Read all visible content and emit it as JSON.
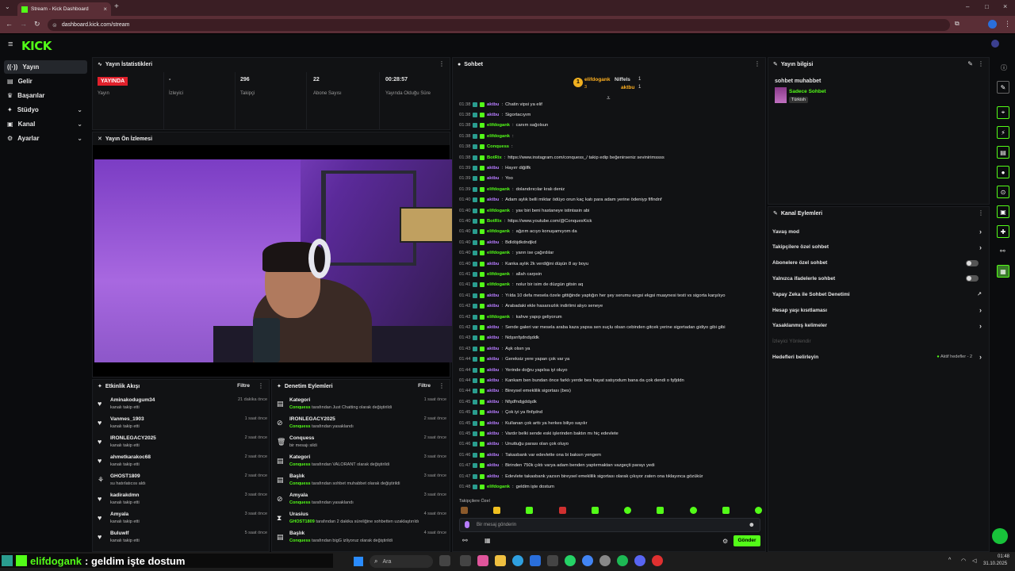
{
  "browser": {
    "tab_title": "Stream - Kick Dashboard",
    "url": "dashboard.kick.com/stream"
  },
  "brand": {
    "logo": "KICK"
  },
  "sidebar": {
    "items": [
      {
        "label": "Yayın"
      },
      {
        "label": "Gelir"
      },
      {
        "label": "Başarılar"
      },
      {
        "label": "Stüdyo"
      },
      {
        "label": "Kanal"
      },
      {
        "label": "Ayarlar"
      }
    ]
  },
  "stats": {
    "title": "Yayın İstatistikleri",
    "live_badge": "YAYINDA",
    "live_label": "Yayın",
    "viewers_value": "-",
    "viewers_label": "İzleyici",
    "followers_value": "296",
    "followers_label": "Takipçi",
    "subs_value": "22",
    "subs_label": "Abone Sayısı",
    "uptime_value": "00:28:57",
    "uptime_label": "Yayında Olduğu Süre"
  },
  "preview": {
    "title": "Yayın Ön İzlemesi"
  },
  "activity": {
    "title": "Etkinlik Akışı",
    "filter": "Filtre",
    "rows": [
      {
        "name": "Aminakodugum34",
        "sub": "kanalı takip etti",
        "time": "21 dakika önce"
      },
      {
        "name": "Vanmes_1903",
        "sub": "kanalı takip etti",
        "time": "1 saat önce"
      },
      {
        "name": "IRONLEGACY2025",
        "sub": "kanalı takip etti",
        "time": "2 saat önce"
      },
      {
        "name": "ahmetkarakoc68",
        "sub": "kanalı takip etti",
        "time": "2 saat önce"
      },
      {
        "name": "GHOST1809",
        "sub": "su hatırlatıcısı aldı",
        "time": "2 saat önce"
      },
      {
        "name": "kadirakdmn",
        "sub": "kanalı takip etti",
        "time": "3 saat önce"
      },
      {
        "name": "Amyala",
        "sub": "kanalı takip etti",
        "time": "3 saat önce"
      },
      {
        "name": "Buluwlf",
        "sub": "kanalı takip etti",
        "time": "5 saat önce"
      }
    ]
  },
  "moderation": {
    "title": "Denetim Eylemleri",
    "filter": "Filtre",
    "rows": [
      {
        "name": "Kategori",
        "actor": "Conquess",
        "sub": "tarafından Just Chatting olarak değiştirildi",
        "time": "1 saat önce"
      },
      {
        "name": "IRONLEGACY2025",
        "actor": "Conquess",
        "sub": "tarafından yasaklandı",
        "time": "2 saat önce"
      },
      {
        "name": "Conquess",
        "actor": "",
        "sub": "bir mesajı sildi",
        "time": "2 saat önce"
      },
      {
        "name": "Kategori",
        "actor": "Conquess",
        "sub": "tarafından VALORANT olarak değiştirildi",
        "time": "3 saat önce"
      },
      {
        "name": "Başlık",
        "actor": "Conquess",
        "sub": "tarafından sohbet muhabbet olarak değiştirildi",
        "time": "3 saat önce"
      },
      {
        "name": "Amyala",
        "actor": "Conquess",
        "sub": "tarafından yasaklandı",
        "time": "3 saat önce"
      },
      {
        "name": "Urasius",
        "actor": "GHOST1809",
        "sub": "tarafından 2 dakika süreliğine sohbetten uzaklaştırıldı",
        "time": "4 saat önce"
      },
      {
        "name": "Başlık",
        "actor": "Conquess",
        "sub": "tarafından bigG izliyoruz olarak değiştirildi",
        "time": "4 saat önce"
      }
    ]
  },
  "chat": {
    "title": "Sohbet",
    "top1": "elifdogank",
    "top1_count": "3",
    "top2": "Niffels",
    "top2_count": "1",
    "top3": "aktbu",
    "top3_count": "1",
    "messages": [
      {
        "t": "01:38",
        "u": "aktbu",
        "c": "purple",
        "m": "Chatin vipsi ya elif"
      },
      {
        "t": "01:38",
        "u": "aktbu",
        "c": "purple",
        "m": "Sigortacıyım"
      },
      {
        "t": "01:38",
        "u": "elifdogank",
        "c": "green",
        "m": "canım sağolsun"
      },
      {
        "t": "01:38",
        "u": "elifdogank",
        "c": "green",
        "m": ""
      },
      {
        "t": "01:38",
        "u": "Conquess",
        "c": "green",
        "m": ""
      },
      {
        "t": "01:38",
        "u": "BotRix",
        "c": "green",
        "m": "https://www.instagram.com/conquess_/ takip edip beğenirseniz sevinirimssss"
      },
      {
        "t": "01:39",
        "u": "aktbu",
        "c": "purple",
        "m": "Hayırr diğilfk"
      },
      {
        "t": "01:39",
        "u": "aktbu",
        "c": "purple",
        "m": "Yoo"
      },
      {
        "t": "01:39",
        "u": "elifdogank",
        "c": "green",
        "m": "dolandırıcılar kralı deniz"
      },
      {
        "t": "01:40",
        "u": "aktbu",
        "c": "purple",
        "m": "Adam aylık belli miktar ödüyo orun kaç katı para adam yerine ödeniyp fiflndnf"
      },
      {
        "t": "01:40",
        "u": "elifdogank",
        "c": "green",
        "m": "yav biri beni hastaneye istintasin abi"
      },
      {
        "t": "01:40",
        "u": "BotRix",
        "c": "green",
        "m": "https://www.youtube.com/@ConquesKick"
      },
      {
        "t": "01:40",
        "u": "elifdogank",
        "c": "green",
        "m": "ağzım acıyo konuşamıyom da"
      },
      {
        "t": "01:40",
        "u": "aktbu",
        "c": "purple",
        "m": "Bdldöjdkdndjkd"
      },
      {
        "t": "01:40",
        "u": "elifdogank",
        "c": "green",
        "m": "yarın ise çağırdılar"
      },
      {
        "t": "01:40",
        "u": "aktbu",
        "c": "purple",
        "m": "Kanka aylık 2k verdiğini düşün 8 ay boyu"
      },
      {
        "t": "01:41",
        "u": "elifdogank",
        "c": "green",
        "m": "allah carpsin"
      },
      {
        "t": "01:41",
        "u": "elifdogank",
        "c": "green",
        "m": "nolur bir isim de düzgün gitsin aq"
      },
      {
        "t": "01:41",
        "u": "aktbu",
        "c": "purple",
        "m": "Yılda 10 defa mesela özele gittiğinde yaptığın her şey serumu eegsi ekgsi muaynesi testi vs sigorta karşılıyo"
      },
      {
        "t": "01:42",
        "u": "aktbu",
        "c": "purple",
        "m": "Arabadaki ekle hasarsızlık indirlimi alıyo seneye"
      },
      {
        "t": "01:42",
        "u": "elifdogank",
        "c": "green",
        "m": "kahve yapıp geliyorum"
      },
      {
        "t": "01:42",
        "u": "aktbu",
        "c": "purple",
        "m": "Sende galeri var mesela araba kaza yapsa sen suçlu olsan cebinden gitcek yerine sigortadan gidiyo gibi gibi"
      },
      {
        "t": "01:43",
        "u": "aktbu",
        "c": "purple",
        "m": "Ndşsnfşdndşddk"
      },
      {
        "t": "01:43",
        "u": "aktbu",
        "c": "purple",
        "m": "Aşk olsın ya"
      },
      {
        "t": "01:44",
        "u": "aktbu",
        "c": "purple",
        "m": "Gereksiz yere yapan çok var ya"
      },
      {
        "t": "01:44",
        "u": "aktbu",
        "c": "purple",
        "m": "Yerinde doğru yapılsa iyi oluyo"
      },
      {
        "t": "01:44",
        "u": "aktbu",
        "c": "purple",
        "m": "Kankam ben bundan önce farklı yerde bes hayat satıyodum bana da çok dendi o fşfjddn"
      },
      {
        "t": "01:44",
        "u": "aktbu",
        "c": "purple",
        "m": "Bireysel emeklilik sigortası (bes)"
      },
      {
        "t": "01:45",
        "u": "aktbu",
        "c": "purple",
        "m": "Nfşdfndşjddşdk"
      },
      {
        "t": "01:45",
        "u": "aktbu",
        "c": "purple",
        "m": "Çok iyi ya flnfşdnd"
      },
      {
        "t": "01:45",
        "u": "aktbu",
        "c": "purple",
        "m": "Kullanan çok arttı ya herkes biliyo sayılır"
      },
      {
        "t": "01:45",
        "u": "aktbu",
        "c": "purple",
        "m": "Vardır belki sende eski işlerinden baktın mı hiç edevlete"
      },
      {
        "t": "01:46",
        "u": "aktbu",
        "c": "purple",
        "m": "Unuttuğu parası olan çok oluyo"
      },
      {
        "t": "01:46",
        "u": "aktbu",
        "c": "purple",
        "m": "Takasbank var edevlette ona bi baksın yengem"
      },
      {
        "t": "01:47",
        "u": "aktbu",
        "c": "purple",
        "m": "Birinden 750k çıktı varya adam benden yaptırmaktan vazgeçti parayı yedi"
      },
      {
        "t": "01:47",
        "u": "aktbu",
        "c": "purple",
        "m": "Edevlete takasbank yazsın bireysel emeklilik sigortası olarak çıkıyor zaten ona tıklayınca gözükür"
      },
      {
        "t": "01:48",
        "u": "elifdogank",
        "c": "green",
        "m": "geldim işte dostum"
      }
    ],
    "followers_only": "Takipçilere Özel",
    "input_placeholder": "Bir mesaj gönderin",
    "send": "Gönder"
  },
  "stream_info": {
    "title": "Yayın bilgisi",
    "stream_title": "sohbet muhabbet",
    "category": "Sadece Sohbet",
    "language": "Türkish"
  },
  "channel_actions": {
    "title": "Kanal Eylemleri",
    "items": [
      {
        "label": "Yavaş mod",
        "type": "arrow"
      },
      {
        "label": "Takipçilere özel sohbet",
        "type": "arrow"
      },
      {
        "label": "Abonelere özel sohbet",
        "type": "toggle"
      },
      {
        "label": "Yalnızca ifadelerle sohbet",
        "type": "toggle"
      },
      {
        "label": "Yapay Zeka ile Sohbet Denetimi",
        "type": "ext"
      },
      {
        "label": "Hesap yaşı kısıtlaması",
        "type": "arrow"
      },
      {
        "label": "Yasaklanmış kelimeler",
        "type": "arrow"
      },
      {
        "label": "İzleyici Yönlendir",
        "type": "none"
      },
      {
        "label": "Hedefleri belirleyin",
        "type": "goal"
      }
    ],
    "goal_status": "Aktif hedefler - 2"
  },
  "overlay": {
    "user": "elifdogank",
    "message": ": geldim işte dostum"
  },
  "taskbar": {
    "search": "Ara",
    "time": "01:48",
    "date": "31.10.2025"
  },
  "colors": {
    "accent": "#53fc18",
    "live": "#e0202b",
    "bg": "#0b0c0e",
    "panel": "#111214"
  }
}
